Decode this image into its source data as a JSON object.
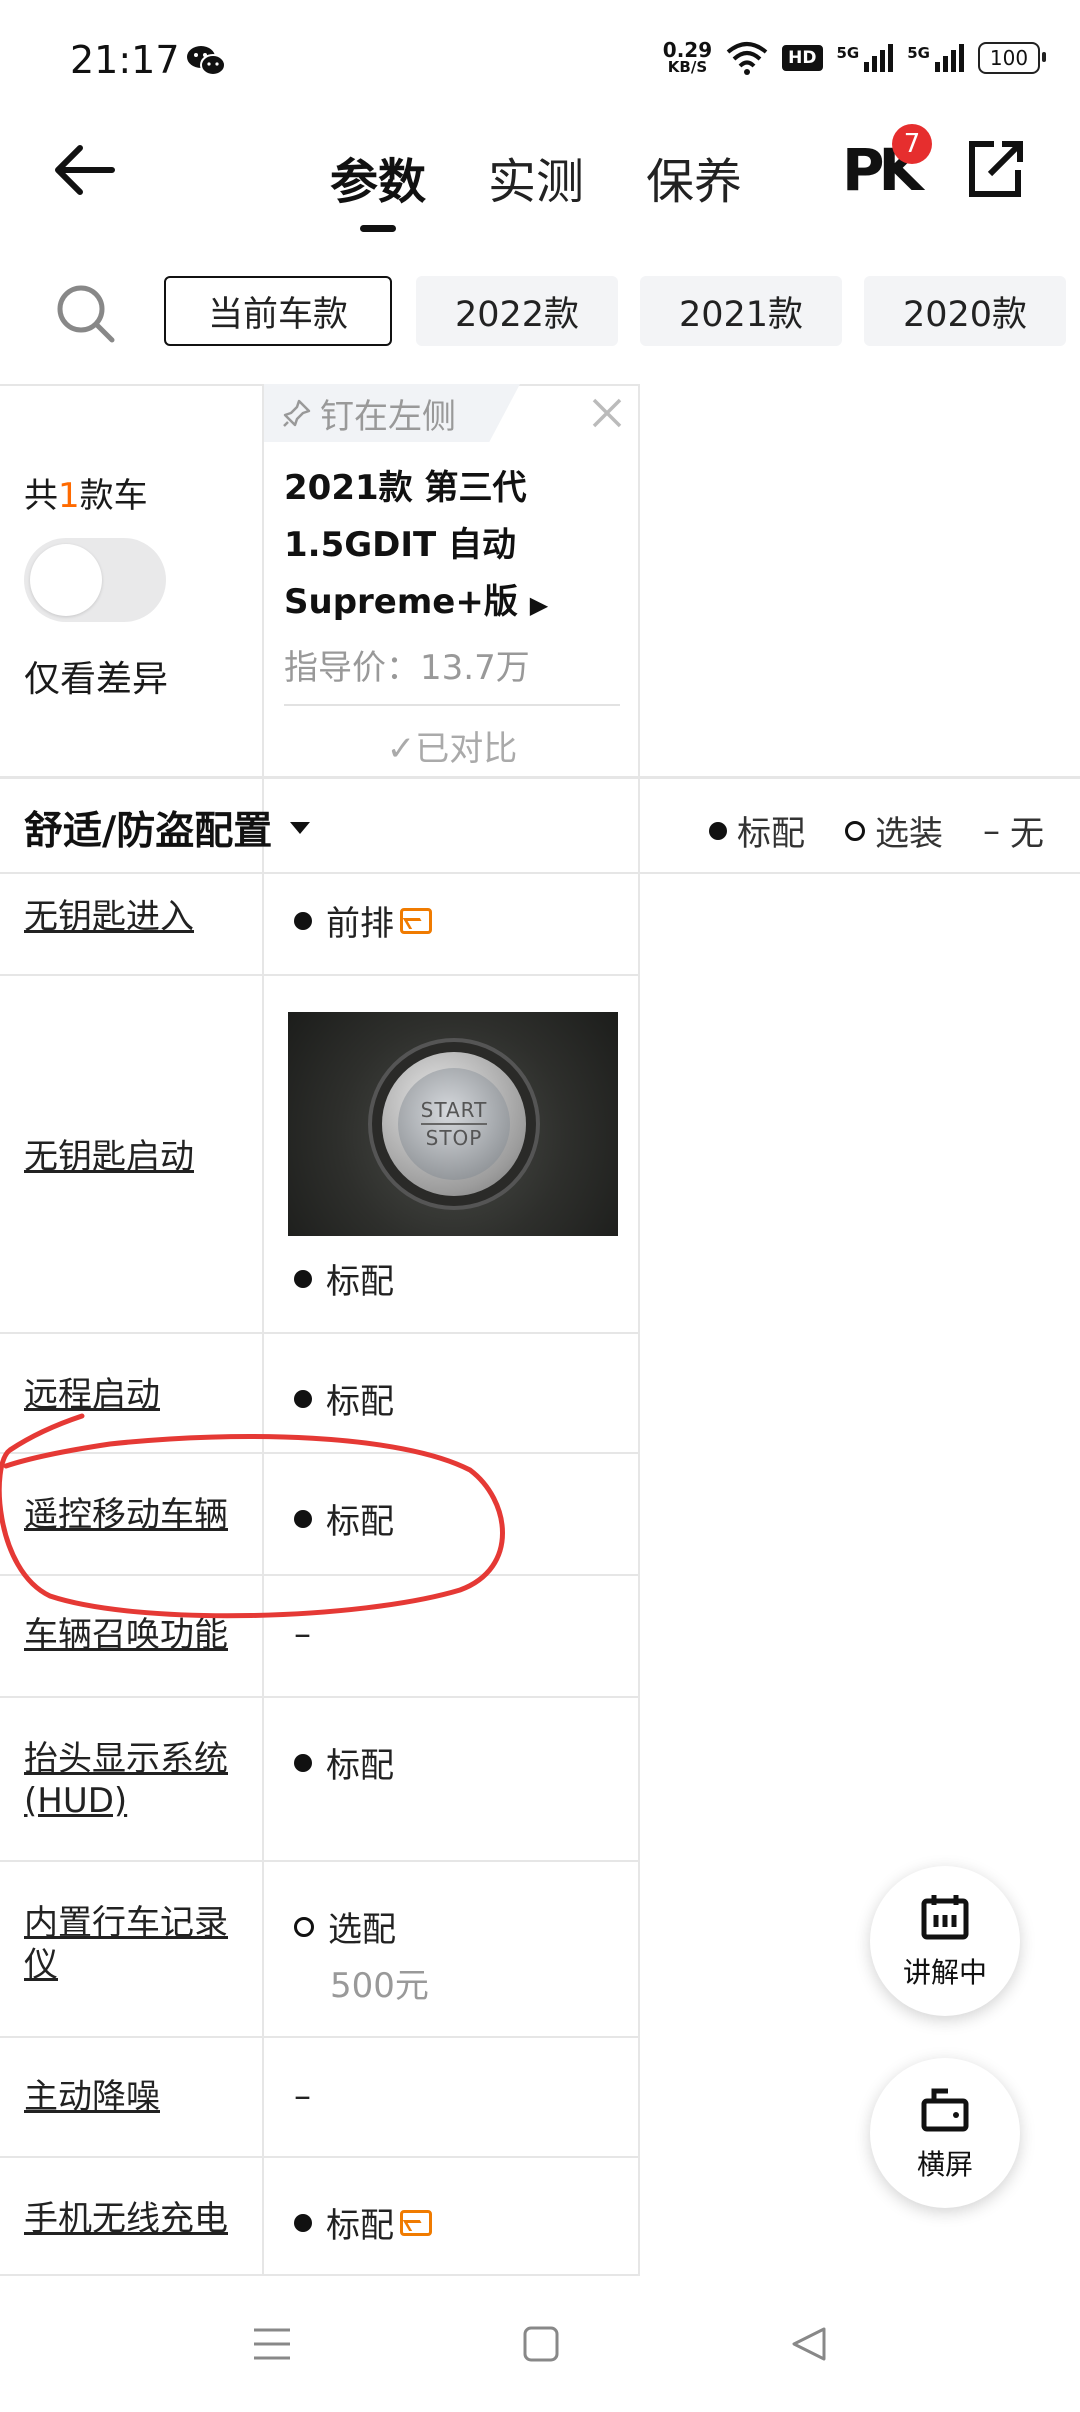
{
  "status_bar": {
    "time": "21:17",
    "net_speed": "0.29",
    "net_unit": "KB/S",
    "hd": "HD",
    "sig1": "5G",
    "sig2": "5G",
    "battery": "100"
  },
  "nav": {
    "tabs": [
      "参数",
      "实测",
      "保养"
    ],
    "active_tab": 0,
    "pk_label": "PK",
    "pk_count": "7"
  },
  "year_filter": {
    "items": [
      "当前车款",
      "2022款",
      "2021款",
      "2020款"
    ],
    "active": 0
  },
  "summary": {
    "count_prefix": "共",
    "count_num": "1",
    "count_suffix": "款车",
    "only_diff_label": "仅看差异",
    "only_diff_on": false
  },
  "car": {
    "pin_label": "钉在左侧",
    "name_line1": "2021款 第三代",
    "name_line2": "1.5GDIT 自动",
    "name_line3": "Supreme+版",
    "price_label": "指导价：13.7万",
    "compared_label": "✓已对比"
  },
  "section": {
    "title": "舒适/防盗配置",
    "legend_std": "标配",
    "legend_opt": "选装",
    "legend_none": "无",
    "legend_none_symbol": "–"
  },
  "rows": [
    {
      "label": "无钥匙进入",
      "value": "前排",
      "mark": "full",
      "has_image_icon": true
    },
    {
      "label": "无钥匙启动",
      "value": "标配",
      "mark": "full",
      "image_text_1": "START",
      "image_text_2": "STOP"
    },
    {
      "label": "远程启动",
      "value": "标配",
      "mark": "full"
    },
    {
      "label": "遥控移动车辆",
      "value": "标配",
      "mark": "full",
      "circled": true
    },
    {
      "label": "车辆召唤功能",
      "value": "–",
      "mark": "none"
    },
    {
      "label": "抬头显示系统(HUD)",
      "value": "标配",
      "mark": "full"
    },
    {
      "label": "内置行车记录仪",
      "value": "选配",
      "mark": "empty",
      "sub": "500元"
    },
    {
      "label": "主动降噪",
      "value": "–",
      "mark": "none"
    },
    {
      "label": "手机无线充电",
      "value": "标配",
      "mark": "full",
      "has_image_icon": true
    }
  ],
  "fabs": {
    "explain": "讲解中",
    "landscape": "横屏"
  },
  "colors": {
    "accent_orange": "#ff6a00",
    "pk_badge": "#e62e2e",
    "annotation_red": "#e53935"
  }
}
